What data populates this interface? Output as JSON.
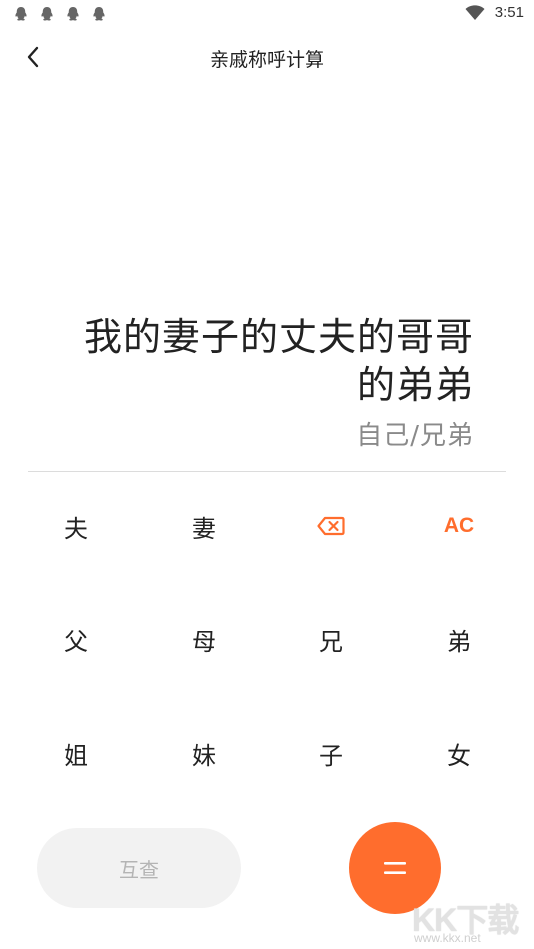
{
  "status_bar": {
    "notification_icons": [
      "qq-icon",
      "qq-icon",
      "qq-icon",
      "qq-icon"
    ],
    "time": "3:51"
  },
  "header": {
    "title": "亲戚称呼计算",
    "back_icon": "chevron-left-icon"
  },
  "display": {
    "expression_lines": [
      "我的妻子的丈夫的哥哥",
      "的弟弟"
    ],
    "result": "自己/兄弟"
  },
  "keypad": {
    "rows": [
      [
        {
          "label": "夫",
          "type": "relation"
        },
        {
          "label": "妻",
          "type": "relation"
        },
        {
          "label": "",
          "type": "backspace",
          "icon": "backspace-icon"
        },
        {
          "label": "AC",
          "type": "clear"
        }
      ],
      [
        {
          "label": "父",
          "type": "relation"
        },
        {
          "label": "母",
          "type": "relation"
        },
        {
          "label": "兄",
          "type": "relation"
        },
        {
          "label": "弟",
          "type": "relation"
        }
      ],
      [
        {
          "label": "姐",
          "type": "relation"
        },
        {
          "label": "妹",
          "type": "relation"
        },
        {
          "label": "子",
          "type": "relation"
        },
        {
          "label": "女",
          "type": "relation"
        }
      ]
    ]
  },
  "actions": {
    "mutual_label": "互查",
    "equals_icon": "equals-icon"
  },
  "watermark": {
    "text": "KK下载",
    "url": "www.kkx.net"
  },
  "colors": {
    "accent": "#ff6d2d",
    "text": "#222222",
    "result_text": "#8a8a8a",
    "disabled_bg": "#f2f2f2",
    "disabled_text": "#b4b4b4",
    "divider": "#dcdcdc"
  }
}
